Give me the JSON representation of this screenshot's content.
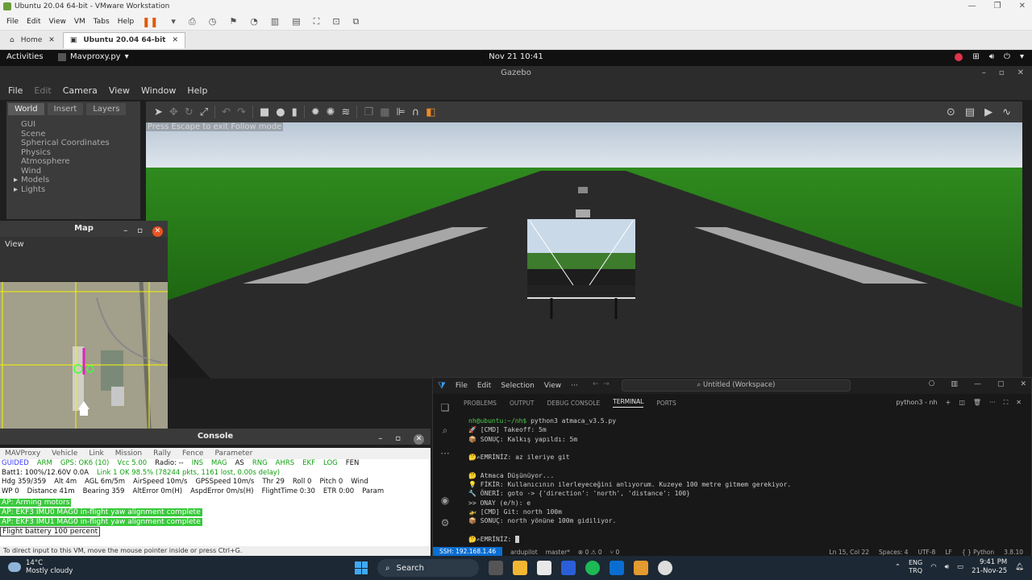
{
  "vmware": {
    "title": "Ubuntu 20.04 64-bit - VMware Workstation",
    "menu": [
      "File",
      "Edit",
      "View",
      "VM",
      "Tabs",
      "Help"
    ],
    "tabs": [
      {
        "label": "Home"
      },
      {
        "label": "Ubuntu 20.04 64-bit"
      }
    ],
    "hint": "To direct input to this VM, move the mouse pointer inside or press Ctrl+G."
  },
  "ubuntu": {
    "activities": "Activities",
    "app": "Mavproxy.py",
    "clock": "Nov 21  10:41"
  },
  "gazebo": {
    "title": "Gazebo",
    "menu": [
      "File",
      "Edit",
      "Camera",
      "View",
      "Window",
      "Help"
    ],
    "left_tabs": [
      "World",
      "Insert",
      "Layers"
    ],
    "tree": [
      "GUI",
      "Scene",
      "Spherical Coordinates",
      "Physics",
      "Atmosphere",
      "Wind",
      "Models",
      "Lights"
    ],
    "esc_hint": "Press Escape to exit Follow mode"
  },
  "map": {
    "title": "Map",
    "view_label": "View"
  },
  "console": {
    "title": "Console",
    "menu": [
      "MAVProxy",
      "Vehicle",
      "Link",
      "Mission",
      "Rally",
      "Fence",
      "Parameter"
    ],
    "status_row1": [
      "GUIDED",
      "ARM",
      "GPS: OK6 (10)",
      "Vcc 5.00",
      "Radio: --",
      "INS",
      "MAG",
      "AS",
      "RNG",
      "AHRS",
      "EKF",
      "LOG",
      "FEN"
    ],
    "status_row2": [
      "Batt1: 100%/12.60V 0.0A",
      "Link 1 OK 98.5% (78244 pkts, 1161 lost, 0.00s delay)"
    ],
    "status_row3": [
      "Hdg 359/359",
      "Alt 4m",
      "AGL 6m/5m",
      "AirSpeed 10m/s",
      "GPSSpeed 10m/s",
      "Thr 29",
      "Roll 0",
      "Pitch 0",
      "Wind"
    ],
    "status_row4": [
      "WP 0",
      "Distance 41m",
      "Bearing 359",
      "AltError 0m(H)",
      "AspdError 0m/s(H)",
      "FlightTime 0:30",
      "ETR 0:00",
      "Param"
    ],
    "log": [
      "AP: Arming motors",
      "AP: EKF3 IMU0 MAG0 in-flight yaw alignment complete",
      "AP: EKF3 IMU1 MAG0 in-flight yaw alignment complete",
      "Flight battery 100 percent"
    ]
  },
  "vscode": {
    "menu": [
      "File",
      "Edit",
      "Selection",
      "View",
      "···"
    ],
    "search": "Untitled (Workspace)",
    "panel_tabs": [
      "PROBLEMS",
      "OUTPUT",
      "DEBUG CONSOLE",
      "TERMINAL",
      "PORTS"
    ],
    "terminal_name": "python3 - nh",
    "terminal": {
      "prompt": "nh@ubuntu:~/nh$",
      "command": " python3 atmaca_v3.5.py",
      "lines": [
        "🚀 [CMD] Takeoff: 5m",
        "📦 SONUÇ: Kalkış yapıldı: 5m",
        "",
        "🤔✍EMRİNİZ: az ileriye git",
        "",
        "🤔 Atmaca Düşünüyor...",
        "💡 FİKİR: Kullanıcının ilerleyeceğini anlıyorum. Kuzeye 100 metre gitmem gerekiyor.",
        "🔧 ÖNERİ: goto -> {'direction': 'north', 'distance': 100}",
        ">> ONAY (e/h): e",
        "🚁 [CMD] Git: north 100m",
        "📦 SONUÇ: north yönüne 100m gidiliyor.",
        "",
        "🤔✍EMRİNİZ: "
      ]
    },
    "status": {
      "ssh": "SSH: 192.168.1.46",
      "branch_repo": "ardupilot",
      "branch": "master*",
      "problems": "⊗ 0 ⚠ 0",
      "ports": "⑂ 0",
      "position": "Ln 15, Col 22",
      "spaces": "Spaces: 4",
      "encoding": "UTF-8",
      "eol": "LF",
      "lang": "{ } Python",
      "version": "3.8.10"
    }
  },
  "taskbar": {
    "temp": "14°C",
    "weather": "Mostly cloudy",
    "search": "Search",
    "lang1": "ENG",
    "lang2": "TRQ",
    "time": "9:41 PM",
    "date": "21-Nov-25"
  },
  "colors": {
    "accent_orange": "#e95420",
    "vscode_blue": "#0a6ed1",
    "console_green": "#39c93c"
  }
}
